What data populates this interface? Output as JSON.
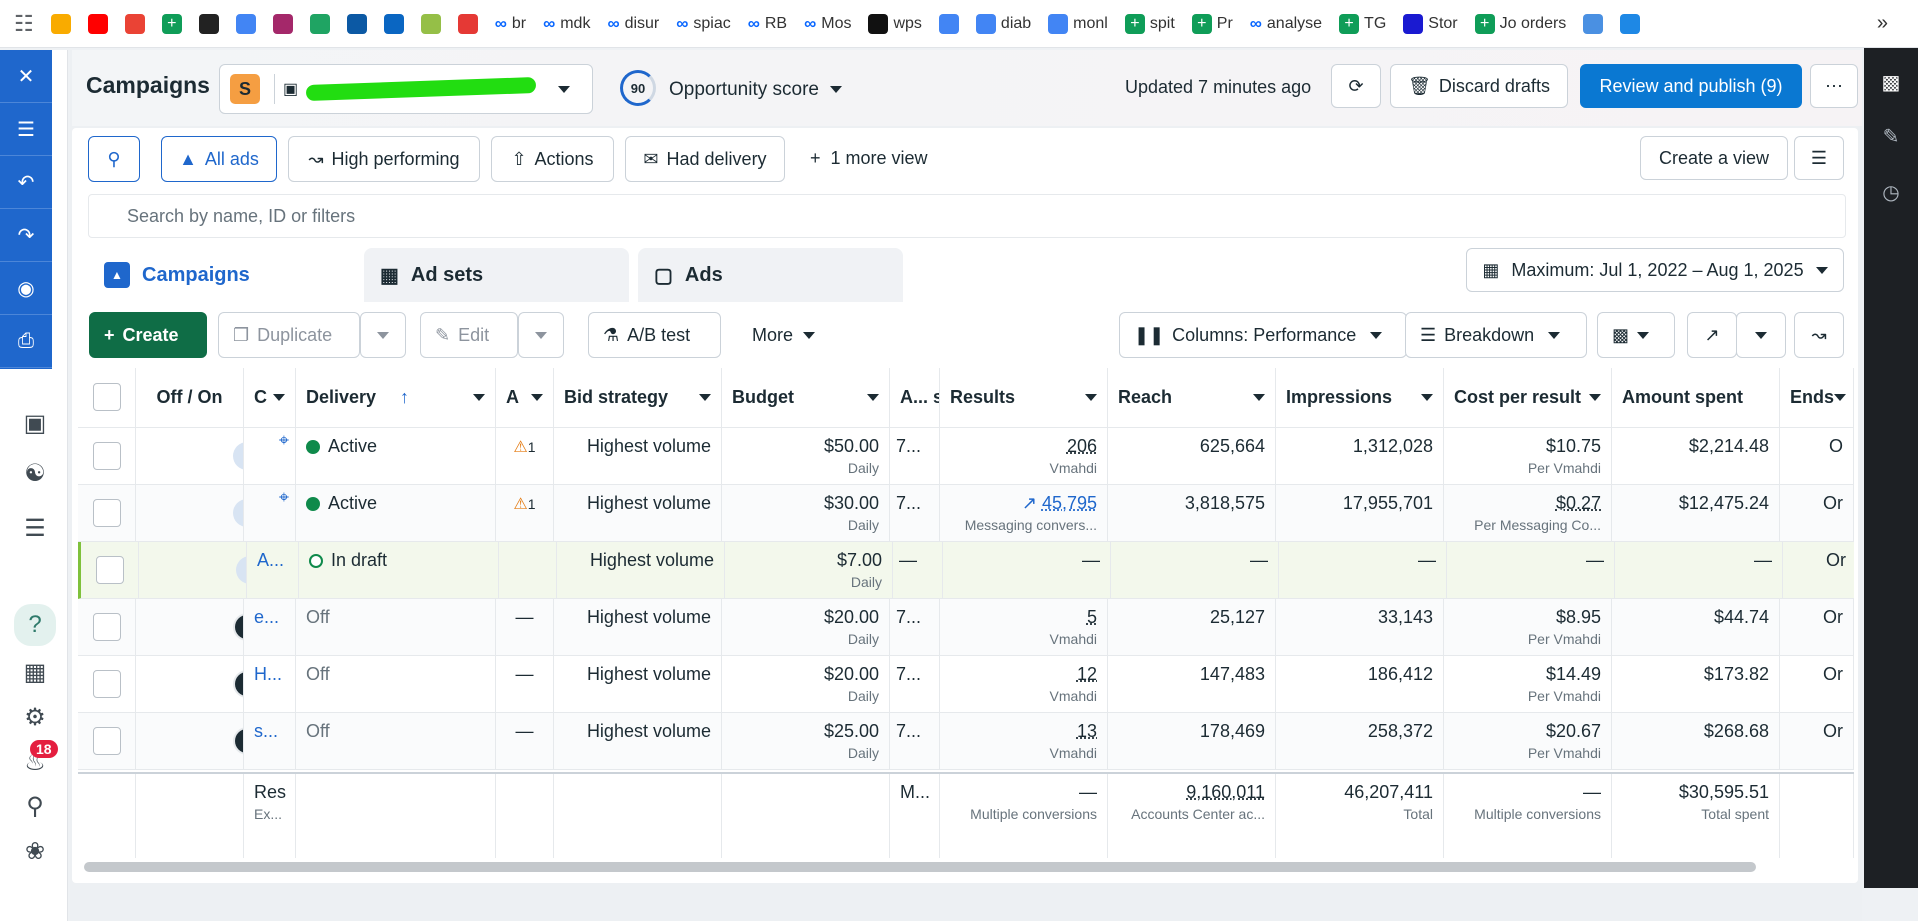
{
  "bookmarks": [
    {
      "label": "",
      "icon": "grid-icon",
      "color": "#5f6368"
    },
    {
      "label": "",
      "icon": "analytics-icon",
      "color": "#f9ab00"
    },
    {
      "label": "",
      "icon": "youtube-icon",
      "color": "#ff0000"
    },
    {
      "label": "",
      "icon": "gmail-icon",
      "color": "#ea4335"
    },
    {
      "label": "",
      "icon": "sheets-icon",
      "color": "#0f9d58"
    },
    {
      "label": "",
      "icon": "openai-icon",
      "color": "#222222"
    },
    {
      "label": "",
      "icon": "translate-icon",
      "color": "#4285f4"
    },
    {
      "label": "",
      "icon": "yoast-icon",
      "color": "#a4286a"
    },
    {
      "label": "",
      "icon": "drive-icon",
      "color": "#1fa463"
    },
    {
      "label": "",
      "icon": "edge-icon",
      "color": "#0c59a4"
    },
    {
      "label": "",
      "icon": "linkedin-icon",
      "color": "#0a66c2"
    },
    {
      "label": "",
      "icon": "shopify-icon",
      "color": "#95bf47"
    },
    {
      "label": "",
      "icon": "heart-icon",
      "color": "#e53935"
    },
    {
      "label": "br",
      "icon": "meta-icon",
      "color": "#0866ff"
    },
    {
      "label": "mdk",
      "icon": "meta-icon",
      "color": "#0866ff"
    },
    {
      "label": "disur",
      "icon": "meta-icon",
      "color": "#0866ff"
    },
    {
      "label": "spiac",
      "icon": "meta-icon",
      "color": "#0866ff"
    },
    {
      "label": "RB",
      "icon": "meta-icon",
      "color": "#0866ff"
    },
    {
      "label": "Mos",
      "icon": "meta-icon",
      "color": "#0866ff"
    },
    {
      "label": "wps",
      "icon": "wps-icon",
      "color": "#111111"
    },
    {
      "label": "",
      "icon": "audio-icon",
      "color": "#4285f4"
    },
    {
      "label": "diab",
      "icon": "ads-icon",
      "color": "#4285f4"
    },
    {
      "label": "monl",
      "icon": "ads-icon",
      "color": "#4285f4"
    },
    {
      "label": "spit",
      "icon": "sheets-icon",
      "color": "#0f9d58"
    },
    {
      "label": "Pr",
      "icon": "sheets-icon",
      "color": "#0f9d58"
    },
    {
      "label": "analyse",
      "icon": "meta-icon",
      "color": "#0866ff"
    },
    {
      "label": "TG",
      "icon": "sheets-icon",
      "color": "#0f9d58"
    },
    {
      "label": "Stor",
      "icon": "globe-icon",
      "color": "#1a1ad1"
    },
    {
      "label": "Jo orders",
      "icon": "sheets-icon",
      "color": "#0f9d58"
    },
    {
      "label": "",
      "icon": "diamond-icon",
      "color": "#4a90e2"
    },
    {
      "label": "",
      "icon": "p-icon",
      "color": "#1e88e5"
    }
  ],
  "header": {
    "title": "Campaigns",
    "account_badge": "S",
    "score_value": "90",
    "score_label": "Opportunity score",
    "updated": "Updated 7 minutes ago",
    "discard": "Discard drafts",
    "publish": "Review and publish (9)",
    "more": "⋯"
  },
  "views": {
    "all": "All ads",
    "high": "High performing",
    "actions": "Actions",
    "delivery": "Had delivery",
    "more": "1 more view",
    "create": "Create a view"
  },
  "search": {
    "placeholder": "Search by name, ID or filters"
  },
  "tabs": {
    "campaigns": "Campaigns",
    "adsets": "Ad sets",
    "ads": "Ads"
  },
  "date_range": "Maximum: Jul 1, 2022 – Aug 1, 2025",
  "toolbar": {
    "create": "Create",
    "duplicate": "Duplicate",
    "edit": "Edit",
    "ab": "A/B test",
    "more": "More",
    "columns": "Columns: Performance",
    "breakdown": "Breakdown"
  },
  "columns": [
    "Off / On",
    "C",
    "Delivery",
    "A",
    "Bid strategy",
    "Budget",
    "A... s...",
    "Results",
    "Reach",
    "Impressions",
    "Cost per result",
    "Amount spent",
    "Ends"
  ],
  "rows": [
    {
      "on": true,
      "name": "",
      "pin": true,
      "delivery": "Active",
      "status": "active",
      "attention": "1",
      "bid": "Highest volume",
      "budget": "$50.00",
      "budget_sub": "Daily",
      "as": "7...",
      "results": "206",
      "results_sub": "Vmahdi",
      "trend": false,
      "reach": "625,664",
      "impressions": "1,312,028",
      "cpr": "$10.75",
      "cpr_sub": "Per Vmahdi",
      "spent": "$2,214.48",
      "ends": "O"
    },
    {
      "on": true,
      "name": "",
      "pin": true,
      "delivery": "Active",
      "status": "active",
      "attention": "1",
      "bid": "Highest volume",
      "budget": "$30.00",
      "budget_sub": "Daily",
      "as": "7...",
      "results": "45,795",
      "results_sub": "Messaging convers...",
      "trend": true,
      "reach": "3,818,575",
      "impressions": "17,955,701",
      "cpr": "$0.27",
      "cpr_sub": "Per Messaging Co...",
      "spent": "$12,475.24",
      "ends": "Or"
    },
    {
      "on": true,
      "name": "A...",
      "pin": false,
      "delivery": "In draft",
      "status": "draft",
      "attention": "",
      "bid": "Highest volume",
      "budget": "$7.00",
      "budget_sub": "Daily",
      "as": "—",
      "results": "—",
      "results_sub": "",
      "trend": false,
      "reach": "—",
      "impressions": "—",
      "cpr": "—",
      "cpr_sub": "",
      "spent": "—",
      "ends": "Or"
    },
    {
      "on": false,
      "name": "e...",
      "pin": false,
      "delivery": "Off",
      "status": "off",
      "attention": "—",
      "bid": "Highest volume",
      "budget": "$20.00",
      "budget_sub": "Daily",
      "as": "7...",
      "results": "5",
      "results_sub": "Vmahdi",
      "trend": false,
      "reach": "25,127",
      "impressions": "33,143",
      "cpr": "$8.95",
      "cpr_sub": "Per Vmahdi",
      "spent": "$44.74",
      "ends": "Or"
    },
    {
      "on": false,
      "name": "H...",
      "pin": false,
      "delivery": "Off",
      "status": "off",
      "attention": "—",
      "bid": "Highest volume",
      "budget": "$20.00",
      "budget_sub": "Daily",
      "as": "7...",
      "results": "12",
      "results_sub": "Vmahdi",
      "trend": false,
      "reach": "147,483",
      "impressions": "186,412",
      "cpr": "$14.49",
      "cpr_sub": "Per Vmahdi",
      "spent": "$173.82",
      "ends": "Or"
    },
    {
      "on": false,
      "name": "s...",
      "pin": false,
      "delivery": "Off",
      "status": "off",
      "attention": "—",
      "bid": "Highest volume",
      "budget": "$25.00",
      "budget_sub": "Daily",
      "as": "7...",
      "results": "13",
      "results_sub": "Vmahdi",
      "trend": false,
      "reach": "178,469",
      "impressions": "258,372",
      "cpr": "$20.67",
      "cpr_sub": "Per Vmahdi",
      "spent": "$268.68",
      "ends": "Or"
    }
  ],
  "totals": {
    "name": "Res",
    "name_sub": "Ex...",
    "as": "M...",
    "results": "—",
    "results_sub": "Multiple conversions",
    "reach": "9,160,011",
    "reach_sub": "Accounts Center ac...",
    "impressions": "46,207,411",
    "impressions_sub": "Total",
    "cpr": "—",
    "cpr_sub": "Multiple conversions",
    "spent": "$30,595.51",
    "spent_sub": "Total spent"
  },
  "left_tools": [
    "close-icon",
    "sliders-icon",
    "undo-icon",
    "redo-icon",
    "camera-icon",
    "print-icon"
  ],
  "sidebar": {
    "notifications": "18"
  },
  "colors": {
    "accent": "#0a78d2",
    "create": "#0f6d46",
    "active": "#0f8a4b"
  }
}
